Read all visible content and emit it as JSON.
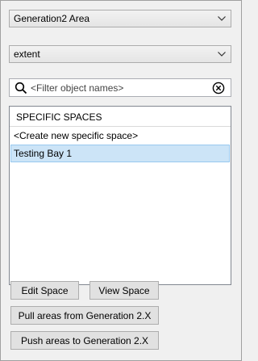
{
  "area_select": {
    "value": "Generation2 Area",
    "icon": "chevron-down-icon"
  },
  "extent_select": {
    "value": "extent",
    "icon": "chevron-down-icon"
  },
  "filter": {
    "placeholder": "<Filter object names>",
    "value": "",
    "search_icon": "search-icon",
    "clear_icon": "clear-circle-x-icon"
  },
  "list": {
    "header": "SPECIFIC SPACES",
    "items": [
      {
        "label": "<Create new specific space>",
        "selected": false
      },
      {
        "label": "Testing Bay 1",
        "selected": true
      }
    ]
  },
  "buttons": {
    "edit_space": "Edit Space",
    "view_space": "View Space",
    "pull_areas": "Pull areas from Generation 2.X",
    "push_areas": "Push areas to Generation 2.X"
  },
  "colors": {
    "selection": "#cce4f7",
    "selection_border": "#99c9ef",
    "panel": "#f0f0f0"
  }
}
